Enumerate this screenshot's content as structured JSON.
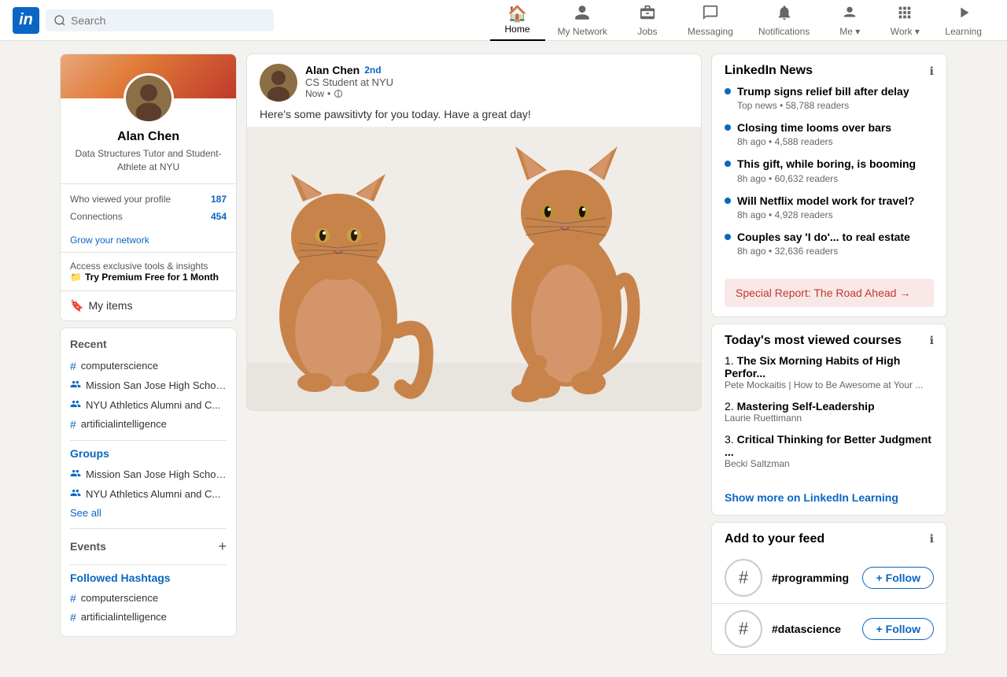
{
  "navbar": {
    "logo": "in",
    "search_placeholder": "Search",
    "nav_items": [
      {
        "id": "home",
        "label": "Home",
        "icon": "🏠",
        "active": true
      },
      {
        "id": "network",
        "label": "My Network",
        "icon": "👥",
        "active": false
      },
      {
        "id": "jobs",
        "label": "Jobs",
        "icon": "💼",
        "active": false
      },
      {
        "id": "messaging",
        "label": "Messaging",
        "icon": "💬",
        "active": false
      },
      {
        "id": "notifications",
        "label": "Notifications",
        "icon": "🔔",
        "active": false
      },
      {
        "id": "me",
        "label": "Me",
        "icon": "👤",
        "has_arrow": true,
        "active": false
      },
      {
        "id": "work",
        "label": "Work",
        "icon": "⠿",
        "has_arrow": true,
        "active": false
      },
      {
        "id": "learning",
        "label": "Learning",
        "icon": "▶",
        "active": false
      }
    ]
  },
  "left_sidebar": {
    "profile": {
      "name": "Alan Chen",
      "title": "Data Structures Tutor and Student-Athlete at NYU",
      "stats": {
        "who_viewed_label": "Who viewed your profile",
        "who_viewed_count": "187",
        "connections_label": "Connections",
        "connections_count": "454",
        "grow_label": "Grow your network"
      },
      "premium": {
        "tagline": "Access exclusive tools & insights",
        "link_label": "Try Premium Free for 1 Month",
        "emoji": "📁"
      },
      "my_items": "My items"
    },
    "recent": {
      "title": "Recent",
      "items": [
        {
          "icon": "#",
          "type": "hash",
          "text": "computerscience"
        },
        {
          "icon": "group",
          "type": "group",
          "text": "Mission San Jose High Schoo..."
        },
        {
          "icon": "group",
          "type": "group",
          "text": "NYU Athletics Alumni and C..."
        },
        {
          "icon": "#",
          "type": "hash",
          "text": "artificialintelligence"
        }
      ]
    },
    "groups": {
      "title": "Groups",
      "items": [
        {
          "icon": "group",
          "text": "Mission San Jose High Schoo..."
        },
        {
          "icon": "group",
          "text": "NYU Athletics Alumni and C..."
        }
      ],
      "see_all": "See all"
    },
    "events": {
      "label": "Events",
      "add_icon": "+"
    },
    "hashtags": {
      "title": "Followed Hashtags",
      "items": [
        {
          "icon": "#",
          "text": "computerscience"
        },
        {
          "icon": "#",
          "text": "artificialintelligence"
        }
      ]
    }
  },
  "post": {
    "author": "Alan Chen",
    "degree": "2nd",
    "subtitle": "CS Student at NYU",
    "time": "Now",
    "body": "Here's some pawsitivty for you today. Have a great day!"
  },
  "right_sidebar": {
    "news": {
      "title": "LinkedIn News",
      "items": [
        {
          "headline": "Trump signs relief bill after delay",
          "meta": "Top news • 58,788 readers"
        },
        {
          "headline": "Closing time looms over bars",
          "meta": "8h ago • 4,588 readers"
        },
        {
          "headline": "This gift, while boring, is booming",
          "meta": "8h ago • 60,632 readers"
        },
        {
          "headline": "Will Netflix model work for travel?",
          "meta": "8h ago • 4,928 readers"
        },
        {
          "headline": "Couples say 'I do'... to real estate",
          "meta": "8h ago • 32,636 readers"
        }
      ],
      "special_report": "Special Report: The Road Ahead →"
    },
    "courses": {
      "title": "Today's most viewed courses",
      "items": [
        {
          "num": "1.",
          "title": "The Six Morning Habits of High Perfor...",
          "author": "Pete Mockaitis | How to Be Awesome at Your ..."
        },
        {
          "num": "2.",
          "title": "Mastering Self-Leadership",
          "author": "Laurie Ruettimann"
        },
        {
          "num": "3.",
          "title": "Critical Thinking for Better Judgment ...",
          "author": "Becki Saltzman"
        }
      ],
      "show_more": "Show more on LinkedIn Learning"
    },
    "feed": {
      "title": "Add to your feed",
      "items": [
        {
          "tag": "#programming",
          "follow_label": "+ Follow"
        },
        {
          "tag": "#datascience",
          "follow_label": "+ Follow"
        }
      ]
    }
  }
}
